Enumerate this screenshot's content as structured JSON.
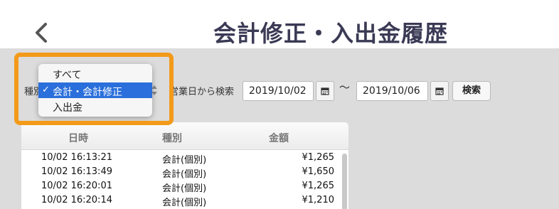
{
  "header": {
    "title": "会計修正・入出金履歴"
  },
  "filter": {
    "type_label": "種別",
    "period_label": "営業日から検索",
    "date_from": "2019/10/02",
    "tilde": "〜",
    "date_to": "2019/10/06",
    "search_label": "検索"
  },
  "dropdown": {
    "items": [
      {
        "label": "すべて",
        "selected": false
      },
      {
        "label": "会計・会計修正",
        "selected": true
      },
      {
        "label": "入出金",
        "selected": false
      }
    ],
    "check_mark": "✓"
  },
  "table": {
    "columns": [
      "日時",
      "種別",
      "金額"
    ],
    "rows": [
      {
        "datetime": "10/02 16:13:21",
        "type": "会計(個別)",
        "amount": "¥1,265"
      },
      {
        "datetime": "10/02 16:13:49",
        "type": "会計(個別)",
        "amount": "¥1,650"
      },
      {
        "datetime": "10/02 16:20:01",
        "type": "会計(個別)",
        "amount": "¥1,265"
      },
      {
        "datetime": "10/02 16:20:14",
        "type": "会計(個別)",
        "amount": "¥1,210"
      }
    ]
  },
  "colors": {
    "accent_highlight": "#f39a1a",
    "selection": "#2a6fdb",
    "title": "#3a3a55"
  }
}
